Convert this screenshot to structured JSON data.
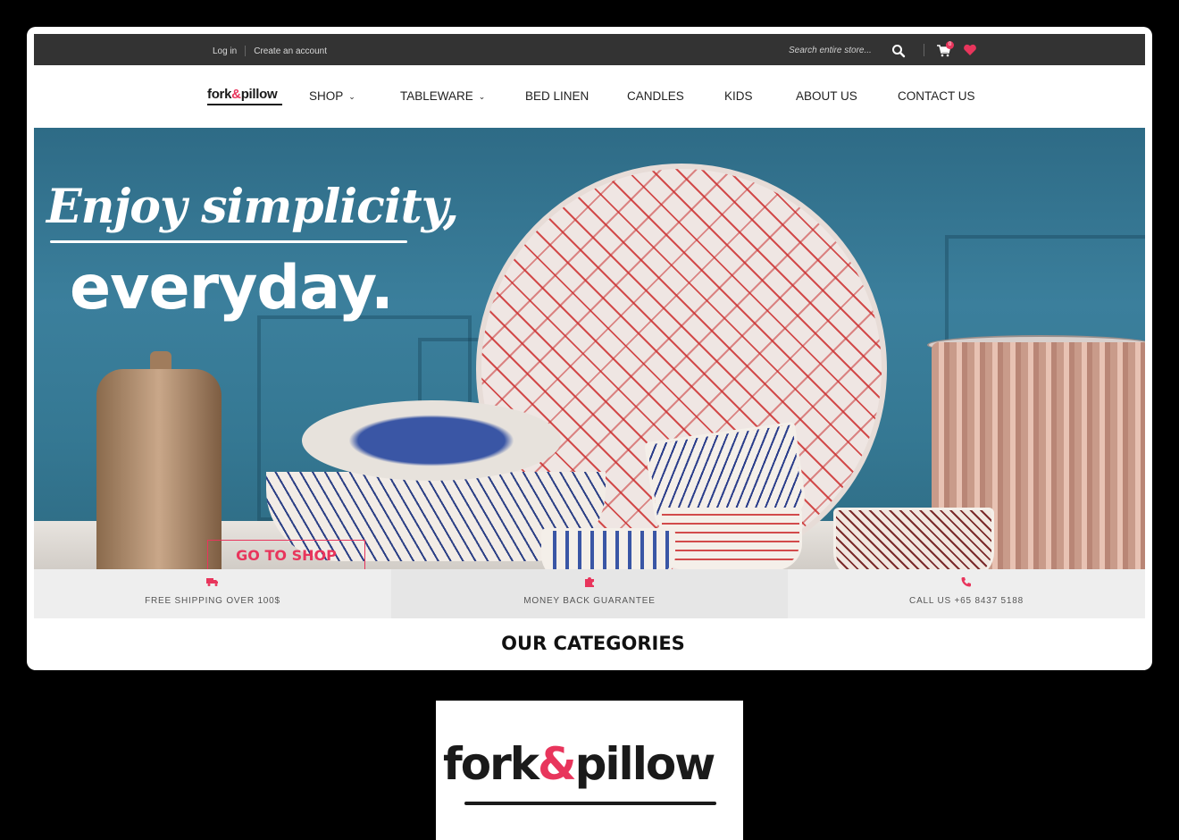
{
  "topbar": {
    "login_label": "Log in",
    "create_account_label": "Create an account",
    "search_placeholder": "Search entire store...",
    "cart_count": "0"
  },
  "logo": {
    "part1": "fork",
    "amp": "&",
    "part2": "pillow"
  },
  "nav": {
    "shop": "SHOP",
    "tableware": "TABLEWARE",
    "bed_linen": "BED LINEN",
    "candles": "CANDLES",
    "kids": "KIDS",
    "about": "ABOUT US",
    "contact": "CONTACT US"
  },
  "hero": {
    "script_line": "Enjoy simplicity,",
    "main_line": "everyday.",
    "button_label": "GO TO SHOP"
  },
  "features": {
    "shipping": "FREE SHIPPING OVER 100$",
    "guarantee": "MONEY BACK GUARANTEE",
    "call": "CALL US +65 8437 5188"
  },
  "categories_title": "OUR CATEGORIES",
  "colors": {
    "accent": "#e8355c",
    "topbar": "#333333"
  }
}
